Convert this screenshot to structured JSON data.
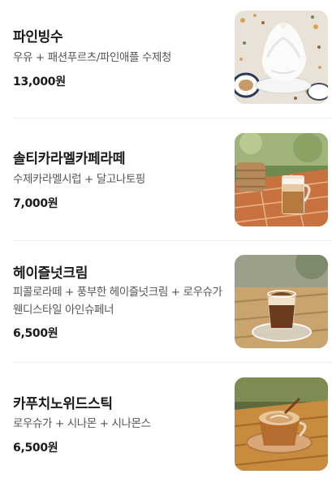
{
  "menu": {
    "items": [
      {
        "name": "파인빙수",
        "description": "우유 + 패션푸르츠/파인애플 수제청",
        "price": "13,000원",
        "image": "bingsu-photo"
      },
      {
        "name": "솔티카라멜카페라떼",
        "description": "수제카라멜시럽 + 달고나토핑",
        "price": "7,000원",
        "image": "caramel-latte-photo"
      },
      {
        "name": "헤이즐넛크림",
        "description": "피콜로라떼 + 풍부한 헤이즐넛크림 + 로우슈가 웬디스타일 아인슈페너",
        "price": "6,500원",
        "image": "hazelnut-cream-photo"
      },
      {
        "name": "카푸치노위드스틱",
        "description": "로우슈가 + 시나몬 + 시나몬스",
        "price": "6,500원",
        "image": "cappuccino-stick-photo"
      }
    ]
  }
}
